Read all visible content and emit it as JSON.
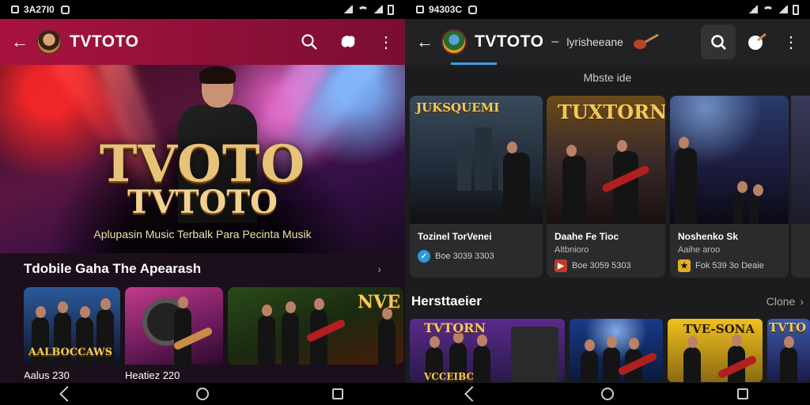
{
  "left": {
    "status": {
      "time": "3A27I0"
    },
    "appbar": {
      "title": "TVTOTO"
    },
    "hero": {
      "title1": "TVOTO",
      "title2": "TVTOTO",
      "subtitle": "Aplupasin Music Terbalk Para Pecinta Musik"
    },
    "section": {
      "title": "Tdobile Gaha The Apearash"
    },
    "cards": [
      {
        "overlay": "AALBOCCAWS",
        "caption": "Aalus 230"
      },
      {
        "overlay": "",
        "caption": "Heatiez 220"
      },
      {
        "overlay": "NVE",
        "caption": ""
      }
    ]
  },
  "right": {
    "status": {
      "time": "94303C"
    },
    "appbar": {
      "title": "TVTOTO",
      "subtitle": "lyrisheeane"
    },
    "section1": {
      "title": "Mbste ide"
    },
    "cards": [
      {
        "overlay": "JUKSQUEMI",
        "title": "Tozinel TorVenei",
        "sub": "",
        "meta": "Boe 3039 3303"
      },
      {
        "overlay": "TUXTORN",
        "title": "Daahe Fe Tioc",
        "sub": "Altbnioro",
        "meta": "Boe 3059 5303"
      },
      {
        "overlay": "",
        "title": "Noshenko Sk",
        "sub": "Aaihe aroo",
        "meta": "Fok 539 3o Deaie"
      }
    ],
    "section2": {
      "title": "Hersttaeier",
      "more": "Clone"
    },
    "tiles": [
      {
        "overlay": "TVTORN",
        "overlay2": "VCCEIBC"
      },
      {
        "overlay": ""
      },
      {
        "overlay": ""
      },
      {
        "overlay": "TVE-SONA"
      },
      {
        "overlay": "TVTO"
      }
    ]
  },
  "colors": {
    "accent_left": "#a8123f",
    "tab_indicator": "#3aa0e8",
    "gold": "#e7c37a"
  }
}
